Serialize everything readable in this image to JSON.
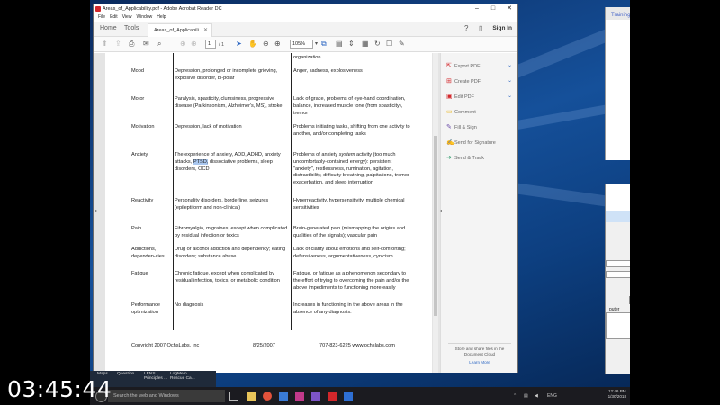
{
  "window": {
    "title": "Areas_of_Applicability.pdf - Adobe Acrobat Reader DC",
    "menu": [
      "File",
      "Edit",
      "View",
      "Window",
      "Help"
    ]
  },
  "tabs": {
    "home": "Home",
    "tools": "Tools",
    "document": "Areas_of_Applicabili..."
  },
  "header": {
    "sign_in": "Sign In"
  },
  "toolbar": {
    "page_current": "1",
    "page_total": "/ 1",
    "zoom": "105%"
  },
  "document": {
    "top_fragment": "organization",
    "rows": [
      {
        "category": "Mood",
        "disorders": "Depression, prolonged or incomplete grieving, explosive disorder, bi-polar",
        "symptoms": "Anger, sadness, explosiveness"
      },
      {
        "category": "Motor",
        "disorders": "Paralysis, spasticity, clumsiness, progressive disease (Parkinsonism, Alzheimer's, MS), stroke",
        "symptoms": "Lack of grace, problems of eye-hand coordination, balance, increased muscle tone (from spasticity), tremor"
      },
      {
        "category": "Motivation",
        "disorders": "Depression, lack of motivation",
        "symptoms": "Problems initiating tasks, shifting from one activity to another, and/or completing tasks"
      },
      {
        "category": "Anxiety",
        "disorders_pre": "The experience of anxiety, ADD, ADHD, anxiety attacks,",
        "disorders_hl": "PTSD,",
        "disorders_post": "dissociative problems, sleep disorders, OCD",
        "symptoms_pre": "Problems of anxiety",
        "symptoms_em": "system",
        "symptoms_post": "activity (too much uncomfortably-contained energy): persistent \"anxiety\", restlessness, rumination, agitation, distractibility, difficulty breathing, palpitations, tremor exacerbation, and sleep interruption"
      },
      {
        "category": "Reactivity",
        "disorders": "Personality disorders, borderline, seizures (epileptiform and non-clinical)",
        "symptoms": "Hyperreactivity, hypersensitivity, multiple chemical sensitivities"
      },
      {
        "category": "Pain",
        "disorders": "Fibromyalgia, migraines, except when complicated by residual infection or toxics",
        "symptoms": "Brain-generated pain (mismapping the origins and qualities of the signals); vascular pain"
      },
      {
        "category": "Addictions, dependen-cies",
        "disorders": "Drug or alcohol addiction and dependency; eating disorders; substance abuse",
        "symptoms": "Lack of clarity about emotions and self-comforting; defensiveness, argumentativeness, cynicism"
      },
      {
        "category": "Fatigue",
        "disorders": "Chronic fatigue, except when complicated by residual infection, toxics, or metabolic condition",
        "symptoms": "Fatigue, or fatigue as a phenomenon secondary to the effort of trying to overcoming the pain and/or the above impediments to functioning more easily"
      },
      {
        "category": "Performance optimization",
        "disorders": "No diagnosis",
        "symptoms": "Increases in functioning in the above areas in the absence of any diagnosis."
      }
    ],
    "footer": {
      "copyright": "Copyright 2007 OchsLabs, Inc",
      "date": "8/25/2007",
      "contact": "707-823-6225  www.ochslabs.com"
    }
  },
  "right_pane": {
    "items": [
      {
        "label": "Export PDF",
        "icon": "export-icon",
        "chevron": true
      },
      {
        "label": "Create PDF",
        "icon": "create-pdf-icon",
        "chevron": true
      },
      {
        "label": "Edit PDF",
        "icon": "edit-icon",
        "chevron": true
      },
      {
        "label": "Comment",
        "icon": "comment-icon",
        "chevron": false
      },
      {
        "label": "Fill & Sign",
        "icon": "sign-icon",
        "chevron": false
      },
      {
        "label": "Send for Signature",
        "icon": "send-signature-icon",
        "chevron": false
      },
      {
        "label": "Send & Track",
        "icon": "send-track-icon",
        "chevron": false
      }
    ],
    "store_text": "Store and share files in the Document Cloud",
    "learn_more": "Learn More"
  },
  "background": {
    "browser_tab": "Training",
    "dialog_label": "puter"
  },
  "taskbar": {
    "pinned": [
      "Maps",
      "Question...",
      "LENS Principles ...",
      "LogMeIn Rescue Ca..."
    ],
    "search_placeholder": "Search the web and Windows",
    "language": "ENG",
    "time": "12:46 PM",
    "date": "1/30/2018"
  },
  "overlay": {
    "timer": "03:45:44"
  }
}
